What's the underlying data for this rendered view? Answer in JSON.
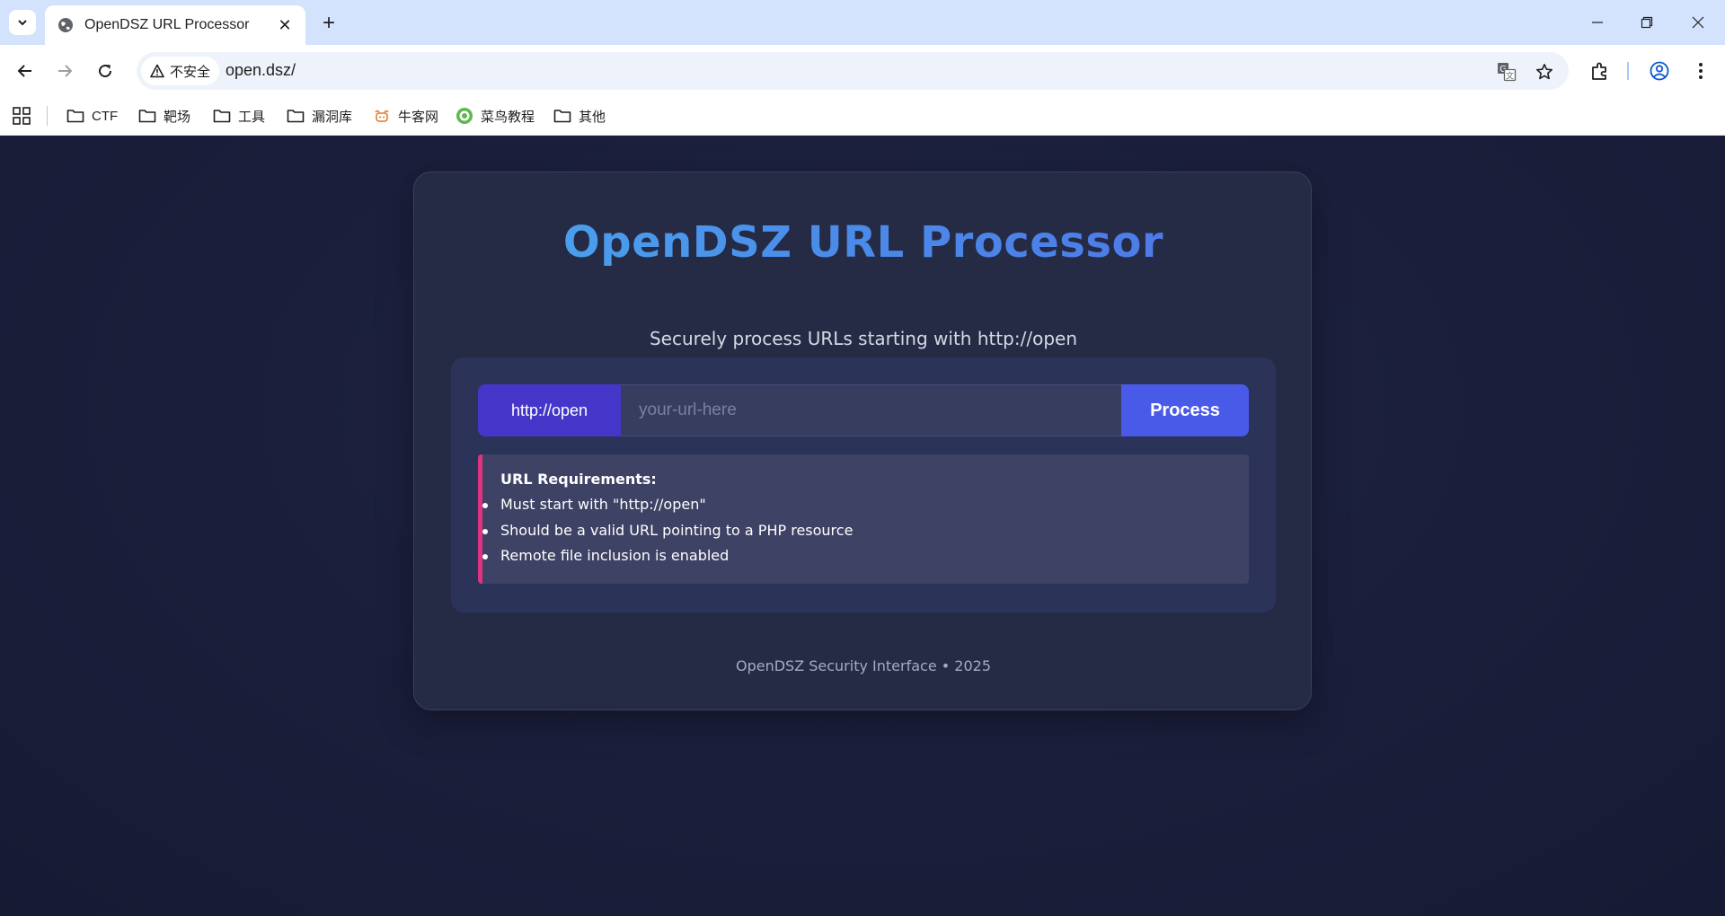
{
  "browser": {
    "tab_title": "OpenDSZ URL Processor",
    "tab_close": "✕",
    "new_tab": "+",
    "security_label": "不安全",
    "url": "open.dsz/"
  },
  "bookmarks": [
    {
      "label": "CTF",
      "icon": "folder-icon"
    },
    {
      "label": "靶场",
      "icon": "folder-icon"
    },
    {
      "label": "工具",
      "icon": "folder-icon"
    },
    {
      "label": "漏洞库",
      "icon": "folder-icon"
    },
    {
      "label": "牛客网",
      "icon": "nowcoder-icon"
    },
    {
      "label": "菜鸟教程",
      "icon": "runoob-icon"
    },
    {
      "label": "其他",
      "icon": "folder-icon"
    }
  ],
  "page": {
    "title": "OpenDSZ URL Processor",
    "subtitle": "Securely process URLs starting with http://open",
    "form": {
      "prefix": "http://open",
      "input_value": "",
      "input_placeholder": "your-url-here",
      "submit_label": "Process"
    },
    "requirements": {
      "title": "URL Requirements:",
      "items": [
        "Must start with \"http://open\"",
        "Should be a valid URL pointing to a PHP resource",
        "Remote file inclusion is enabled"
      ]
    },
    "footer": "OpenDSZ Security Interface • 2025"
  },
  "colors": {
    "page_background": "#1b1f3c",
    "card_background": "#252a45",
    "title_gradient_start": "#4aa8f0",
    "title_gradient_end": "#4f74e6",
    "prefix_background": "#4536c9",
    "button_background": "#4a5ae8",
    "requirements_accent": "#e0337f"
  }
}
